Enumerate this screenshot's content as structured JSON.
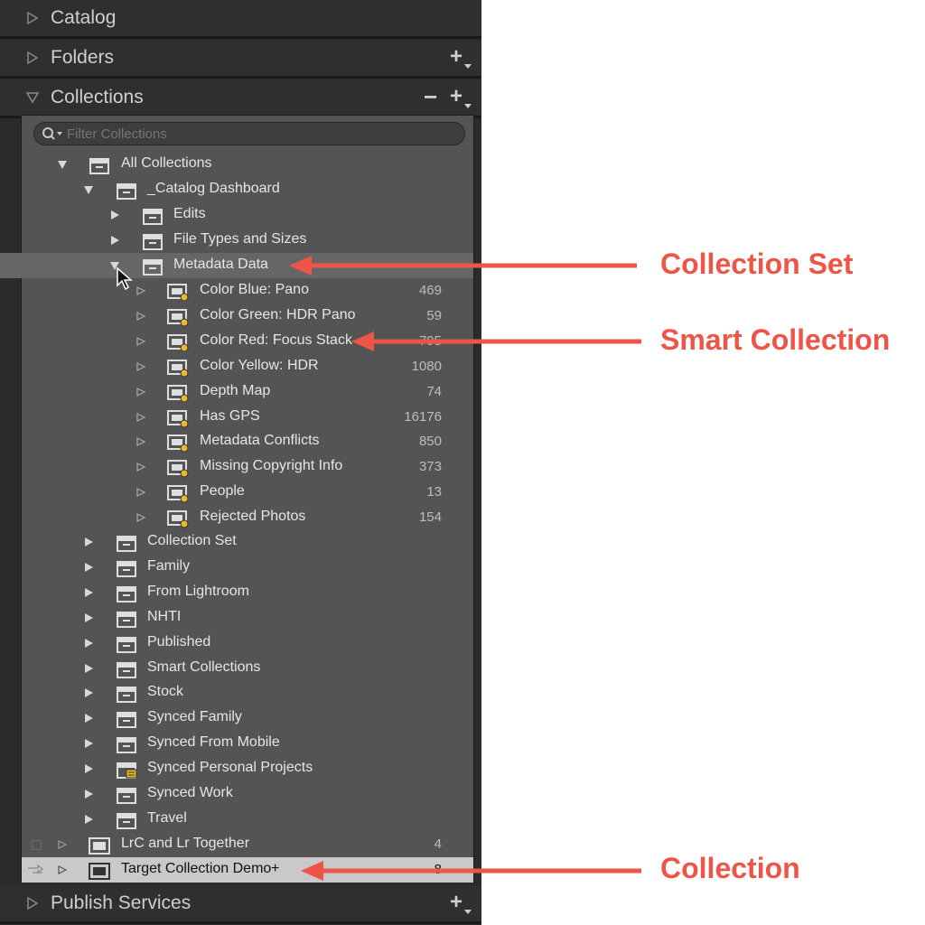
{
  "panels": {
    "catalog": "Catalog",
    "folders": "Folders",
    "collections": "Collections",
    "publish": "Publish Services"
  },
  "filter": {
    "placeholder": "Filter Collections"
  },
  "tree": {
    "all_collections": "All Collections",
    "catalog_dashboard": "_Catalog Dashboard",
    "edits": "Edits",
    "file_types": "File Types and Sizes",
    "metadata_data": "Metadata Data",
    "smart": [
      {
        "label": "Color Blue: Pano",
        "count": "469"
      },
      {
        "label": "Color Green: HDR Pano",
        "count": "59"
      },
      {
        "label": "Color Red: Focus Stack",
        "count": "795"
      },
      {
        "label": "Color Yellow: HDR",
        "count": "1080"
      },
      {
        "label": "Depth Map",
        "count": "74"
      },
      {
        "label": "Has GPS",
        "count": "16176"
      },
      {
        "label": "Metadata Conflicts",
        "count": "850"
      },
      {
        "label": "Missing Copyright Info",
        "count": "373"
      },
      {
        "label": "People",
        "count": "13"
      },
      {
        "label": "Rejected Photos",
        "count": "154"
      }
    ],
    "sets": [
      "Collection Set",
      "Family",
      "From Lightroom",
      "NHTI",
      "Published",
      "Smart Collections",
      "Stock",
      "Synced Family",
      "Synced From Mobile",
      "Synced Personal Projects",
      "Synced Work",
      "Travel"
    ],
    "lrc_together": {
      "label": "LrC and Lr Together",
      "count": "4"
    },
    "target": {
      "label": "Target Collection Demo",
      "marker": "+",
      "count": "8"
    }
  },
  "annotations": {
    "collection_set": "Collection Set",
    "smart_collection": "Smart Collection",
    "collection": "Collection"
  },
  "colors": {
    "annotation": "#ee5546",
    "panel_bg": "#2b2b2b",
    "list_bg": "#545454"
  }
}
